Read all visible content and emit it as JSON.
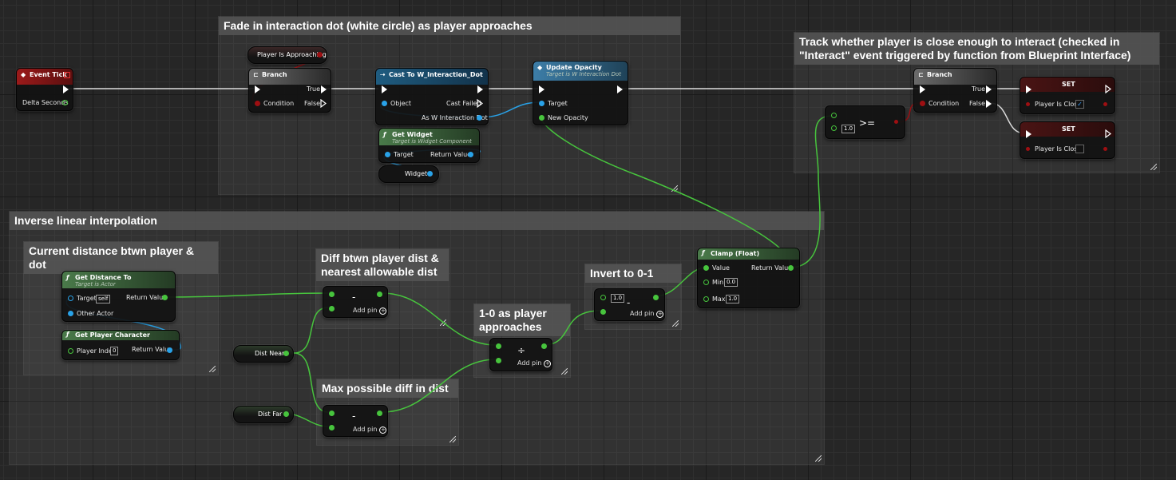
{
  "comments": {
    "fade": "Fade in interaction dot (white circle) as player approaches",
    "track": "Track whether player is close enough to interact (checked in \"Interact\" event triggered by function from Blueprint Interface)",
    "inverse": "Inverse linear interpolation",
    "current": "Current distance btwn player & dot",
    "diff1": "Diff btwn player dist & nearest allowable dist",
    "invert": "Invert to 0-1",
    "approach": "1-0 as player approaches",
    "maxdiff": "Max possible diff in dist"
  },
  "nodes": {
    "event_tick": {
      "title": "Event Tick",
      "out": "Delta Seconds"
    },
    "branch1": {
      "title": "Branch",
      "cond": "Condition",
      "true": "True",
      "false": "False"
    },
    "player_approaching": "Player Is Approaching",
    "cast": {
      "title": "Cast To W_Interaction_Dot",
      "object": "Object",
      "failed": "Cast Failed",
      "as": "As W Interaction Dot"
    },
    "update_opacity": {
      "title": "Update Opacity",
      "subtitle": "Target is W Interaction Dot",
      "target": "Target",
      "opacity": "New Opacity"
    },
    "get_widget": {
      "title": "Get Widget",
      "subtitle": "Target is Widget Component",
      "target": "Target",
      "ret": "Return Value"
    },
    "widget_var": "Widget",
    "gte": {
      "op": ">=",
      "value": "1.0"
    },
    "branch2": {
      "title": "Branch",
      "cond": "Condition",
      "true": "True",
      "false": "False"
    },
    "set1": {
      "title": "SET",
      "label": "Player Is Close",
      "checked": true
    },
    "set2": {
      "title": "SET",
      "label": "Player Is Close",
      "checked": false
    },
    "get_distance": {
      "title": "Get Distance To",
      "subtitle": "Target is Actor",
      "target": "Target",
      "self": "self",
      "other": "Other Actor",
      "ret": "Return Value"
    },
    "get_player": {
      "title": "Get Player Character",
      "index_label": "Player Index",
      "index": "0",
      "ret": "Return Value"
    },
    "dist_near": "Dist Near",
    "dist_far": "Dist Far",
    "sub1": {
      "op": "-",
      "addpin": "Add pin"
    },
    "sub2": {
      "op": "-",
      "addpin": "Add pin"
    },
    "div": {
      "op": "÷",
      "addpin": "Add pin"
    },
    "sub3": {
      "op": "-",
      "value": "1.0",
      "addpin": "Add pin"
    },
    "clamp": {
      "title": "Clamp (Float)",
      "value": "Value",
      "ret": "Return Value",
      "min": "Min",
      "min_val": "0.0",
      "max": "Max",
      "max_val": "1.0"
    }
  },
  "colors": {
    "exec": "#ffffff",
    "float": "#47c43d",
    "object": "#29a2e8",
    "bool": "#9e0f12",
    "event_header": "#8a1414",
    "cast_header": "#1d4f6e",
    "func_header": "#2e4a2a",
    "branch_header": "#5a5a5a"
  }
}
